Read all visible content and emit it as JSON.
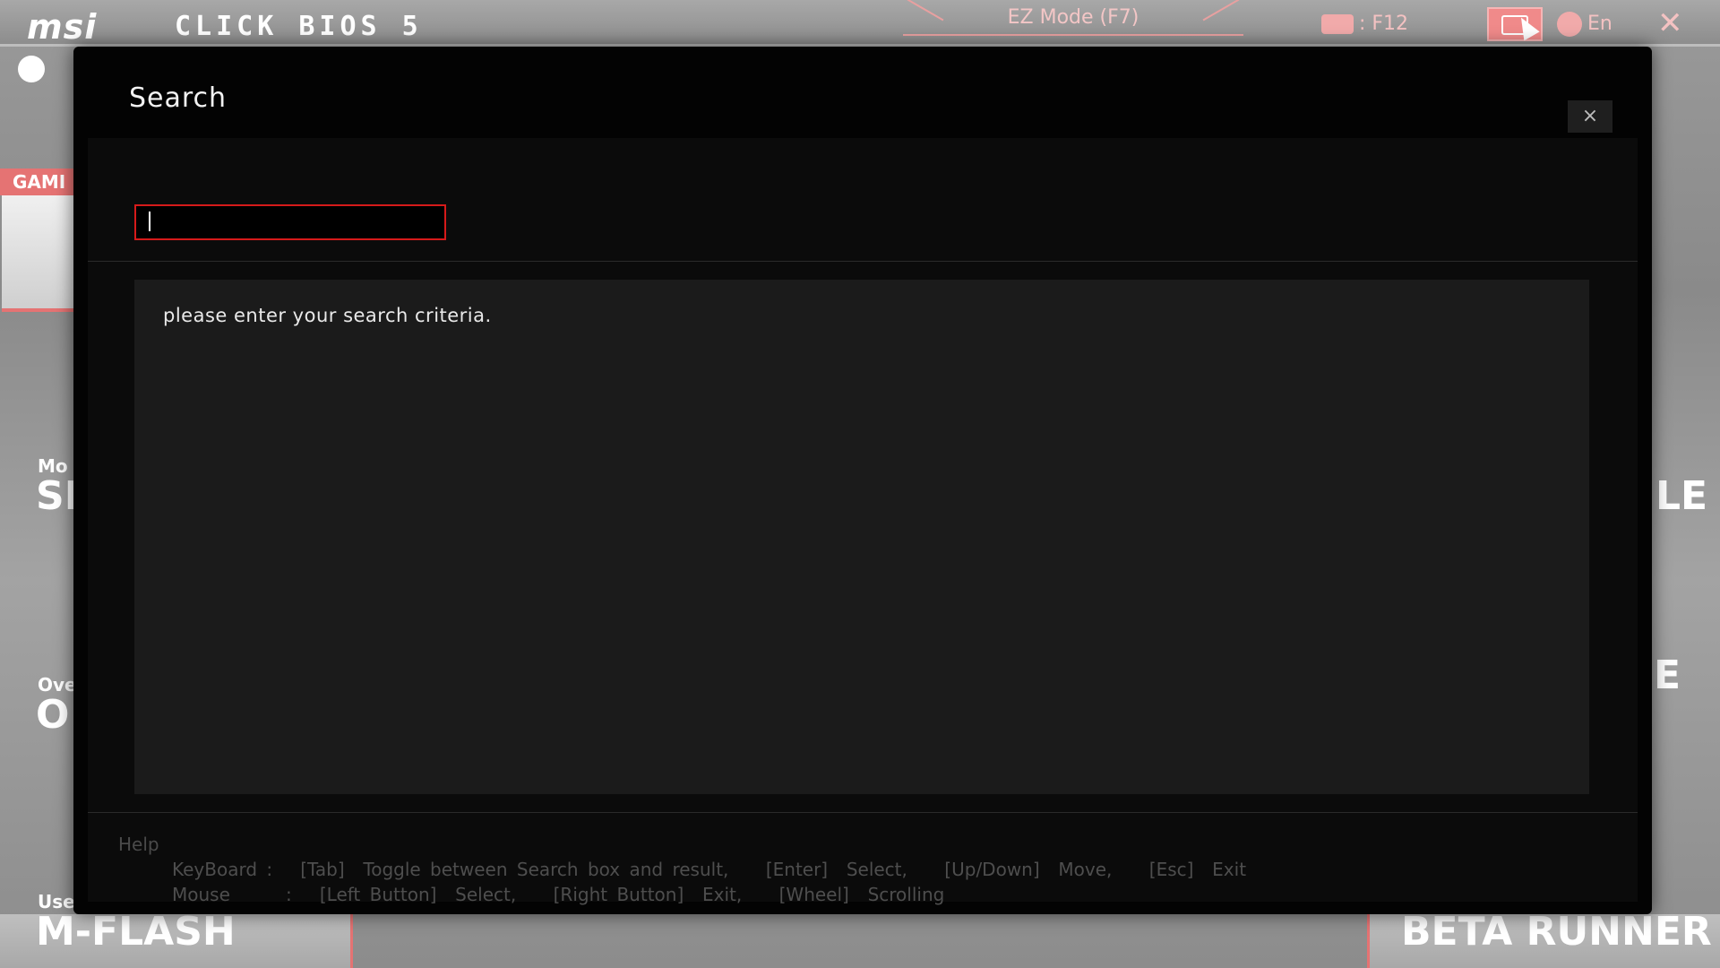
{
  "header": {
    "logo": "msi",
    "bios_title": "CLICK BIOS 5",
    "ez_mode": "EZ Mode (F7)",
    "screenshot_key": ": F12",
    "language": "En",
    "close_symbol": "✕"
  },
  "background": {
    "game_tab": "GAMI",
    "labels": [
      {
        "text": "Mo",
        "size": "small"
      },
      {
        "text": "SI",
        "size": "big"
      },
      {
        "text": "Ove",
        "size": "small"
      },
      {
        "text": "O",
        "size": "big"
      },
      {
        "text": "Use",
        "size": "small"
      },
      {
        "text": "LE",
        "size": "big"
      },
      {
        "text": "E",
        "size": "big"
      }
    ],
    "mflash": "M-FLASH",
    "beta_runner": "BETA RUNNER"
  },
  "modal": {
    "title": "Search",
    "close_symbol": "×",
    "search": {
      "value": "",
      "placeholder": ""
    },
    "results_message": "please enter your search criteria.",
    "help": {
      "title": "Help",
      "keyboard_line": "KeyBoard :   [Tab]  Toggle between Search box and result,    [Enter]  Select,    [Up/Down]  Move,    [Esc]  Exit",
      "mouse_line": "Mouse      :   [Left Button]  Select,    [Right Button]  Exit,    [Wheel]  Scrolling"
    }
  },
  "colors": {
    "accent_red": "#d61a1a",
    "pink": "#f08a8a",
    "modal_bg": "#030303",
    "results_bg": "#1b1b1b"
  },
  "icons": {
    "clock": "clock-icon",
    "camera": "camera-icon",
    "search": "search-icon",
    "globe": "globe-icon",
    "close": "close-icon",
    "cursor": "mouse-pointer-icon"
  }
}
